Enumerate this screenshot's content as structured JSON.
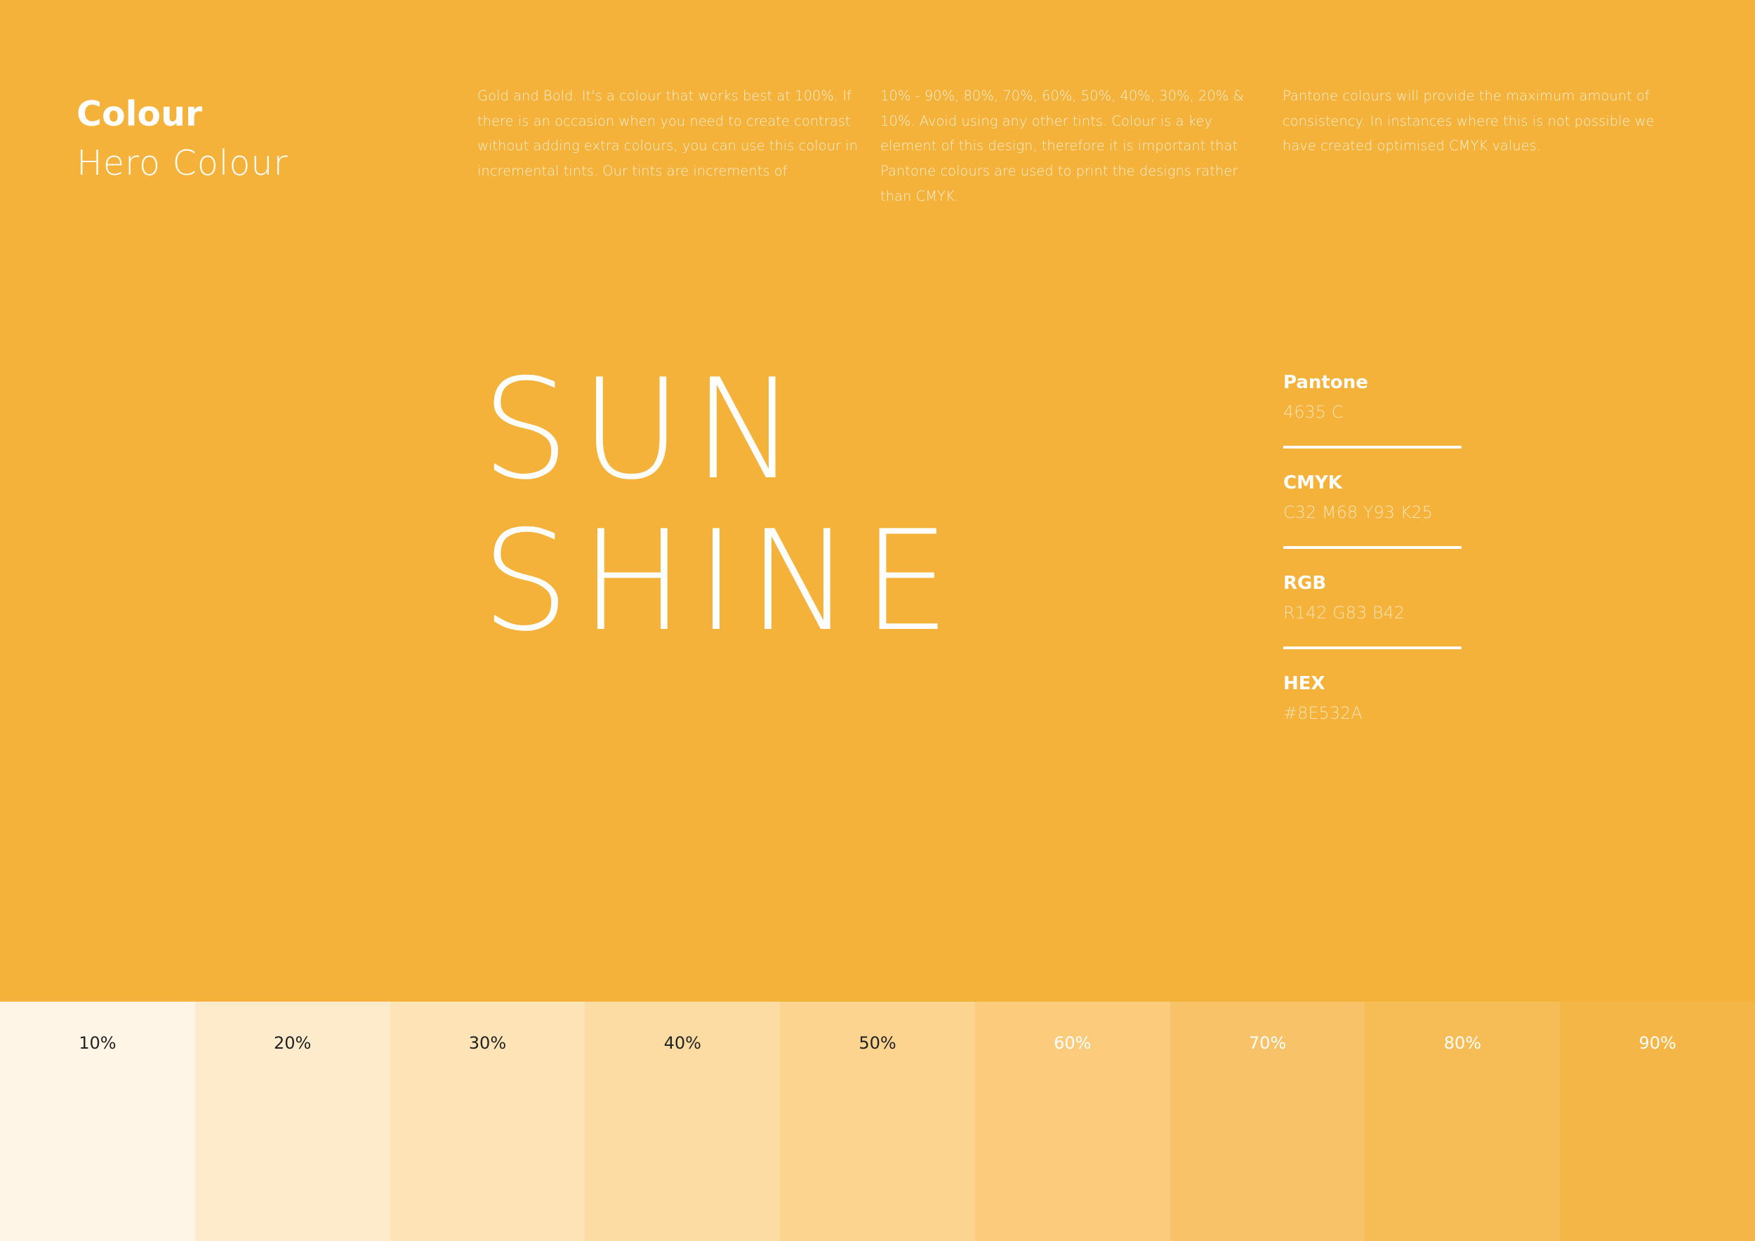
{
  "heading": {
    "title": "Colour",
    "subtitle": "Hero Colour"
  },
  "intro": {
    "col1": "Gold and Bold. It's a colour that works best at 100%. If there is an occasion when you need to create contrast without adding extra colours, you can use this colour in incremental tints. Our tints are increments of",
    "col2": "10% - 90%, 80%, 70%, 60%, 50%, 40%, 30%, 20% & 10%. Avoid using any other tints. Colour is a key element of this design, therefore it is important that Pantone colours are used to print the designs rather than CMYK.",
    "col3": "Pantone colours will provide the maximum amount of consistency. In instances where this is not possible we have created optimised CMYK values."
  },
  "hero": {
    "line1": "SUN",
    "line2": "SHINE"
  },
  "specs": [
    {
      "label": "Pantone",
      "value": "4635 C"
    },
    {
      "label": "CMYK",
      "value": "C32 M68 Y93 K25"
    },
    {
      "label": "RGB",
      "value": "R142 G83 B42"
    },
    {
      "label": "HEX",
      "value": "#8E532A"
    }
  ],
  "colors": {
    "page_background": "#F4B23A",
    "text": "#FFFFFF"
  },
  "tints": [
    {
      "label": "10%",
      "color": "#FEF5E6",
      "text_color": "#222222"
    },
    {
      "label": "20%",
      "color": "#FDEBCB",
      "text_color": "#222222"
    },
    {
      "label": "30%",
      "color": "#FDE3B6",
      "text_color": "#222222"
    },
    {
      "label": "40%",
      "color": "#FCDCA2",
      "text_color": "#222222"
    },
    {
      "label": "50%",
      "color": "#FCD38F",
      "text_color": "#222222"
    },
    {
      "label": "60%",
      "color": "#FCCB7C",
      "text_color": "#FFFFFF"
    },
    {
      "label": "70%",
      "color": "#F8C368",
      "text_color": "#FFFFFF"
    },
    {
      "label": "80%",
      "color": "#F6BC55",
      "text_color": "#FFFFFF"
    },
    {
      "label": "90%",
      "color": "#F5B648",
      "text_color": "#FFFFFF"
    }
  ]
}
